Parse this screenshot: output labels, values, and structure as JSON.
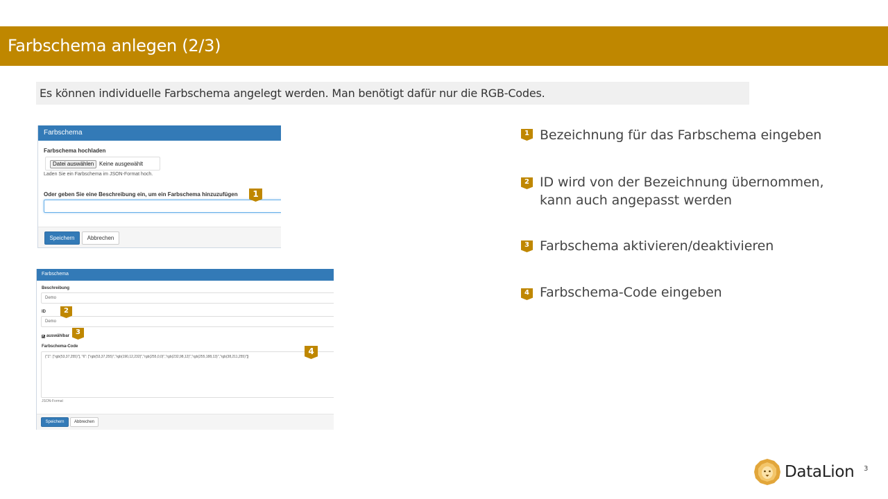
{
  "slide": {
    "title": "Farbschema anlegen (2/3)",
    "intro": "Es können individuelle Farbschema angelegt werden. Man benötigt dafür nur die RGB-Codes.",
    "page_number": "3"
  },
  "panel_upload": {
    "header": "Farbschema",
    "upload_label": "Farbschema hochladen",
    "file_button": "Datei auswählen",
    "file_status": "Keine ausgewählt",
    "upload_help": "Laden Sie ein Farbschema im JSON-Format hoch.",
    "description_label": "Oder geben Sie eine Beschreibung ein, um ein Farbschema hinzuzufügen",
    "description_value": "",
    "save_label": "Speichern",
    "cancel_label": "Abbrechen"
  },
  "panel_edit": {
    "header": "Farbschema",
    "beschreibung_label": "Beschreibung",
    "beschreibung_value": "Demo",
    "id_label": "ID",
    "id_value": "Demo",
    "selectable_label": "auswählbar",
    "selectable_checked": true,
    "code_label": "Farbschema-Code",
    "code_value": "{\"1\": [\"rgb(53,37,255)\"], \"6\": [\"rgb(53,37,255)\",\"rgb(190,12,232)\",\"rgb(255,0,0)\",\"rgb(232,98,12)\",\"rgb(255,188,13)\",\"rgb(38,211,255)\"]}",
    "code_help": "JSON-Format",
    "save_label": "Speichern",
    "cancel_label": "Abbrechen"
  },
  "markers": [
    "1",
    "2",
    "3",
    "4"
  ],
  "steps": [
    {
      "number": "1",
      "text": "Bezeichnung für das Farbschema eingeben"
    },
    {
      "number": "2",
      "text": "ID wird von der Bezeichnung übernommen, kann auch angepasst werden"
    },
    {
      "number": "3",
      "text": "Farbschema aktivieren/deaktivieren"
    },
    {
      "number": "4",
      "text": "Farbschema-Code eingeben"
    }
  ],
  "brand": {
    "name": "DataLion",
    "logo_icon": "lion-head-icon",
    "accent_color": "#bf8700",
    "panel_color": "#337ab7"
  }
}
